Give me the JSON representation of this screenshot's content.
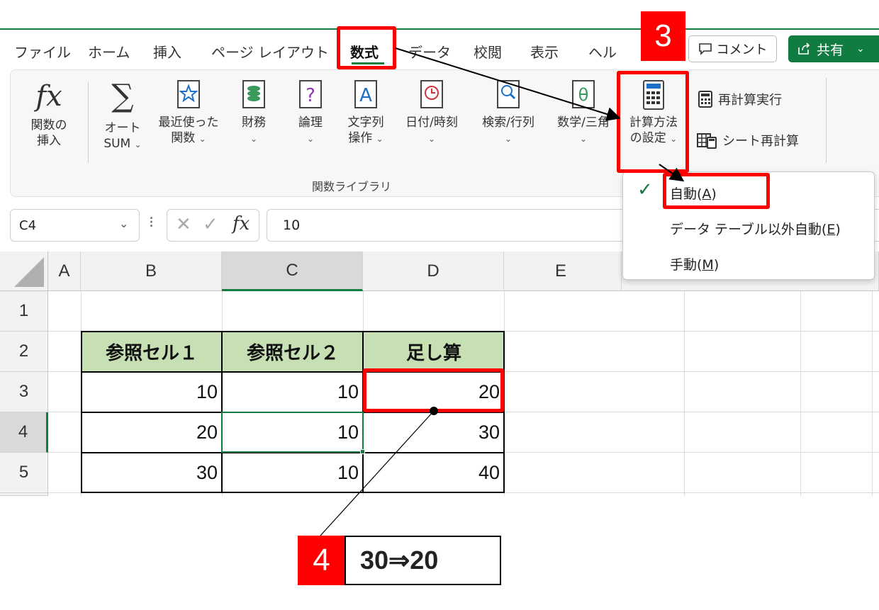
{
  "tabs": [
    {
      "label": "ファイル"
    },
    {
      "label": "ホーム"
    },
    {
      "label": "挿入"
    },
    {
      "label": "ページ レイアウト"
    },
    {
      "label": "数式"
    },
    {
      "label": "データ"
    },
    {
      "label": "校閲"
    },
    {
      "label": "表示"
    },
    {
      "label": "ヘル"
    }
  ],
  "header_buttons": {
    "comment": "コメント",
    "share": "共有"
  },
  "ribbon": {
    "insert_function": {
      "line1": "関数の",
      "line2": "挿入"
    },
    "autosum": {
      "line1": "オート",
      "line2": "SUM"
    },
    "recent": {
      "line1": "最近使った",
      "line2": "関数"
    },
    "financial": {
      "line1": "財務"
    },
    "logical": {
      "line1": "論理"
    },
    "text": {
      "line1": "文字列",
      "line2": "操作"
    },
    "datetime": {
      "line1": "日付/時刻"
    },
    "lookup": {
      "line1": "検索/行列"
    },
    "math": {
      "line1": "数学/三角"
    },
    "calc_options": {
      "line1": "計算方法",
      "line2": "の設定"
    },
    "calc_now": "再計算実行",
    "calc_sheet": "シート再計算",
    "group_label": "関数ライブラリ"
  },
  "dropdown": {
    "items": [
      {
        "label": "自動(",
        "key": "A",
        "end": ")",
        "checked": true
      },
      {
        "label": "データ テーブル以外自動(",
        "key": "E",
        "end": ")"
      },
      {
        "label": "手動(",
        "key": "M",
        "end": ")"
      }
    ]
  },
  "formula_bar": {
    "name_box": "C4",
    "value": "10"
  },
  "columns": [
    "A",
    "B",
    "C",
    "D",
    "E"
  ],
  "rows": [
    "1",
    "2",
    "3",
    "4",
    "5"
  ],
  "table": {
    "headers": [
      "参照セル１",
      "参照セル２",
      "足し算"
    ],
    "data": [
      [
        "10",
        "10",
        "20"
      ],
      [
        "20",
        "10",
        "30"
      ],
      [
        "30",
        "10",
        "40"
      ]
    ]
  },
  "annotations": {
    "step3": "3",
    "step4": "4",
    "result": "30⇒20"
  },
  "colors": {
    "excel_green": "#107c41",
    "header_fill": "#c6e0b4",
    "annotation_red": "#ff0000"
  }
}
